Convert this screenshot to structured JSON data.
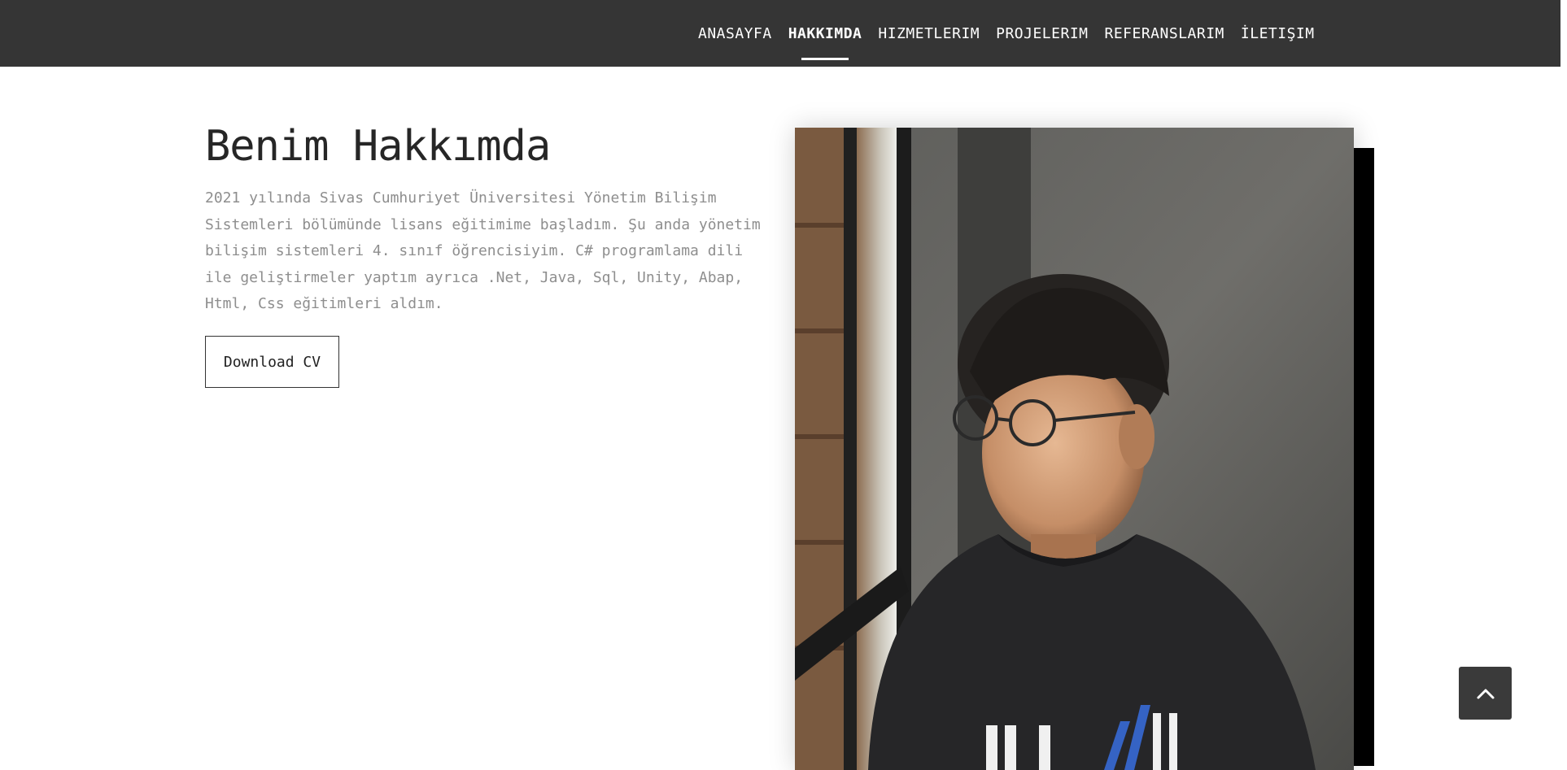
{
  "nav": {
    "items": [
      {
        "label": "ANASAYFA",
        "active": false
      },
      {
        "label": "HAKKIMDA",
        "active": true
      },
      {
        "label": "HIZMETLERIM",
        "active": false
      },
      {
        "label": "PROJELERIM",
        "active": false
      },
      {
        "label": "REFERANSLARIM",
        "active": false
      },
      {
        "label": "İLETIŞIM",
        "active": false
      }
    ]
  },
  "about": {
    "title": "Benim Hakkımda",
    "text": "2021 yılında Sivas Cumhuriyet Üniversitesi Yönetim Bilişim Sistemleri bölümünde lisans eğitimime başladım. Şu anda yönetim bilişim sistemleri 4. sınıf öğrencisiyim. C# programlama dili ile geliştirmeler yaptım ayrıca .Net, Java, Sql, Unity, Abap, Html, Css eğitimleri aldım.",
    "cv_button": "Download CV"
  },
  "photo": {
    "subject": "profile-photo-young-man-glasses-window"
  },
  "scroll_top": {
    "icon": "chevron-up-icon"
  },
  "colors": {
    "navbar": "#353535",
    "title": "#262626",
    "body_text": "#8e8e8e",
    "button_border": "#333333",
    "scroll_button": "#3a3a3a"
  }
}
